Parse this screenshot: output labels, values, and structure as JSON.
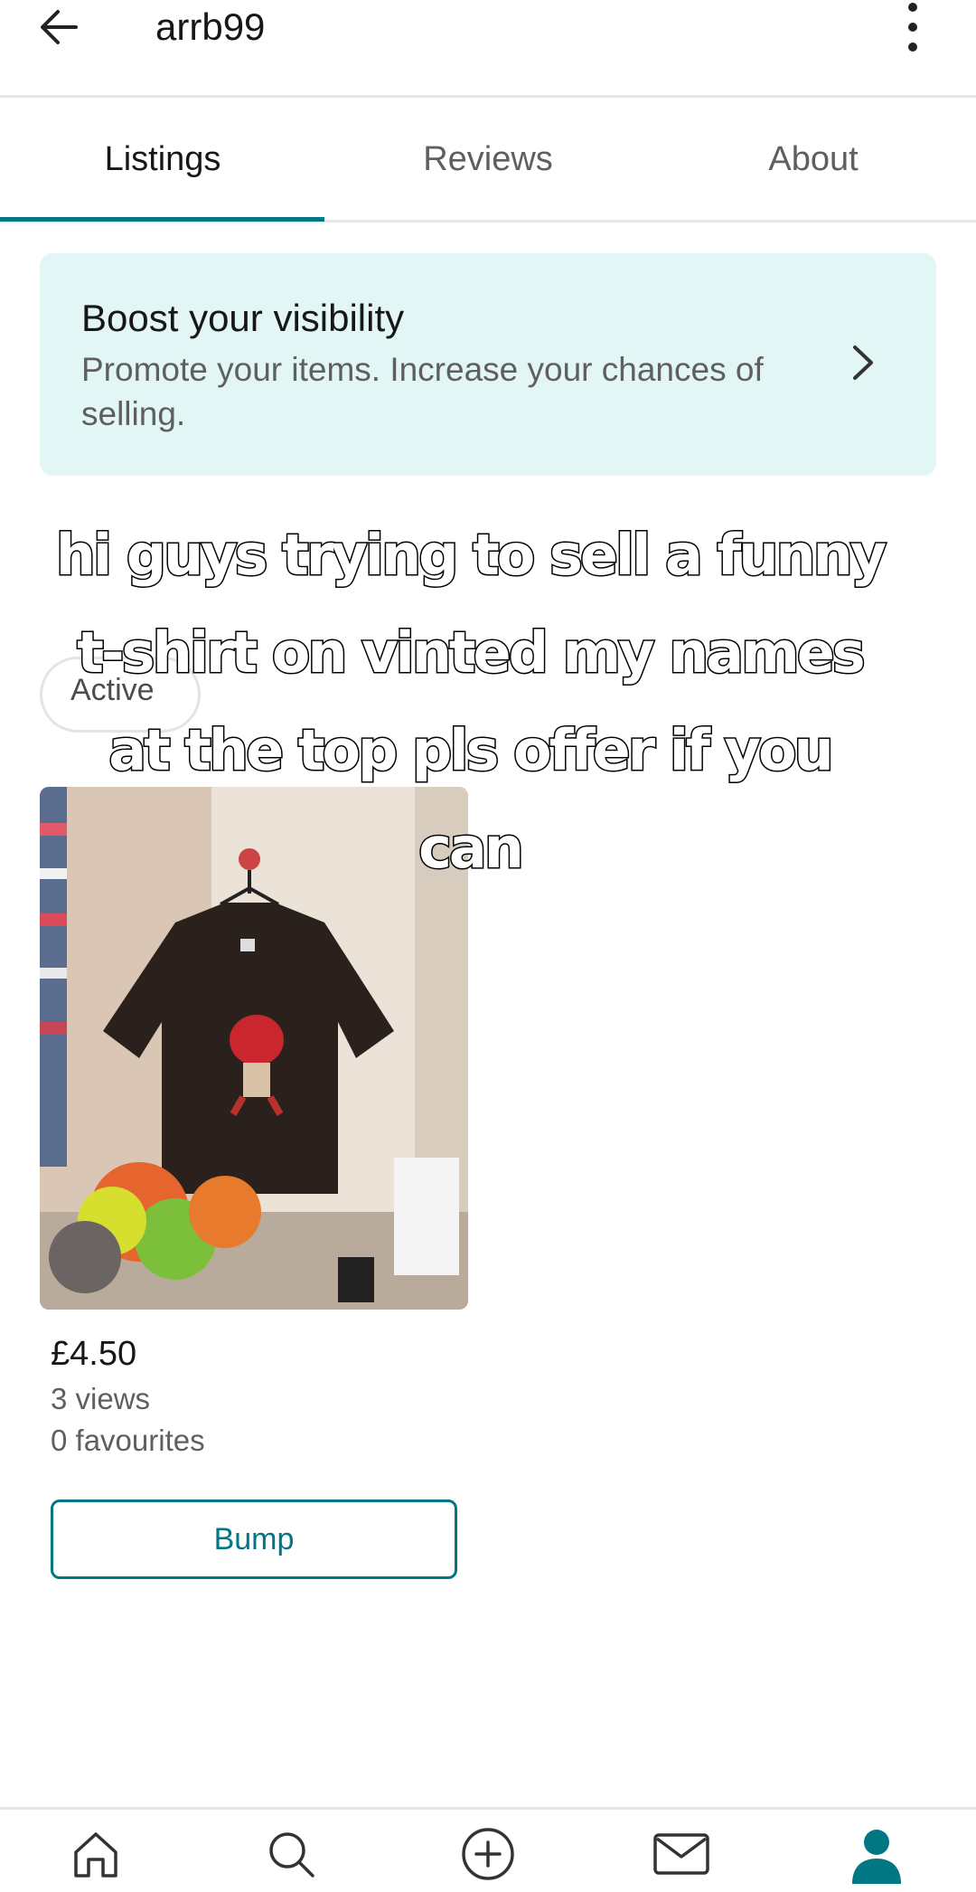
{
  "header": {
    "username": "arrb99",
    "back_icon": "arrow-left-icon",
    "menu_icon": "more-vertical-icon"
  },
  "tabs": [
    {
      "label": "Listings",
      "active": true
    },
    {
      "label": "Reviews",
      "active": false
    },
    {
      "label": "About",
      "active": false
    }
  ],
  "boost_banner": {
    "title": "Boost your visibility",
    "description": "Promote your items. Increase your chances of selling.",
    "icon": "chevron-right-icon"
  },
  "listing": {
    "status": "Active",
    "price": "£4.50",
    "views": "3 views",
    "favourites": "0 favourites",
    "bump_label": "Bump"
  },
  "caption": {
    "lines": [
      "hi guys trying to sell a funny",
      "t-shirt on vinted my names",
      "at the top pls offer if you",
      "can"
    ]
  },
  "bottom_nav": [
    {
      "name": "home",
      "icon": "home-icon"
    },
    {
      "name": "search",
      "icon": "search-icon"
    },
    {
      "name": "sell",
      "icon": "plus-circle-icon"
    },
    {
      "name": "inbox",
      "icon": "mail-icon"
    },
    {
      "name": "profile",
      "icon": "user-icon",
      "active": true
    }
  ],
  "colors": {
    "accent": "#007782",
    "banner_bg": "#e1f6f5",
    "text_primary": "#171717",
    "text_secondary": "#5f5f5f"
  }
}
